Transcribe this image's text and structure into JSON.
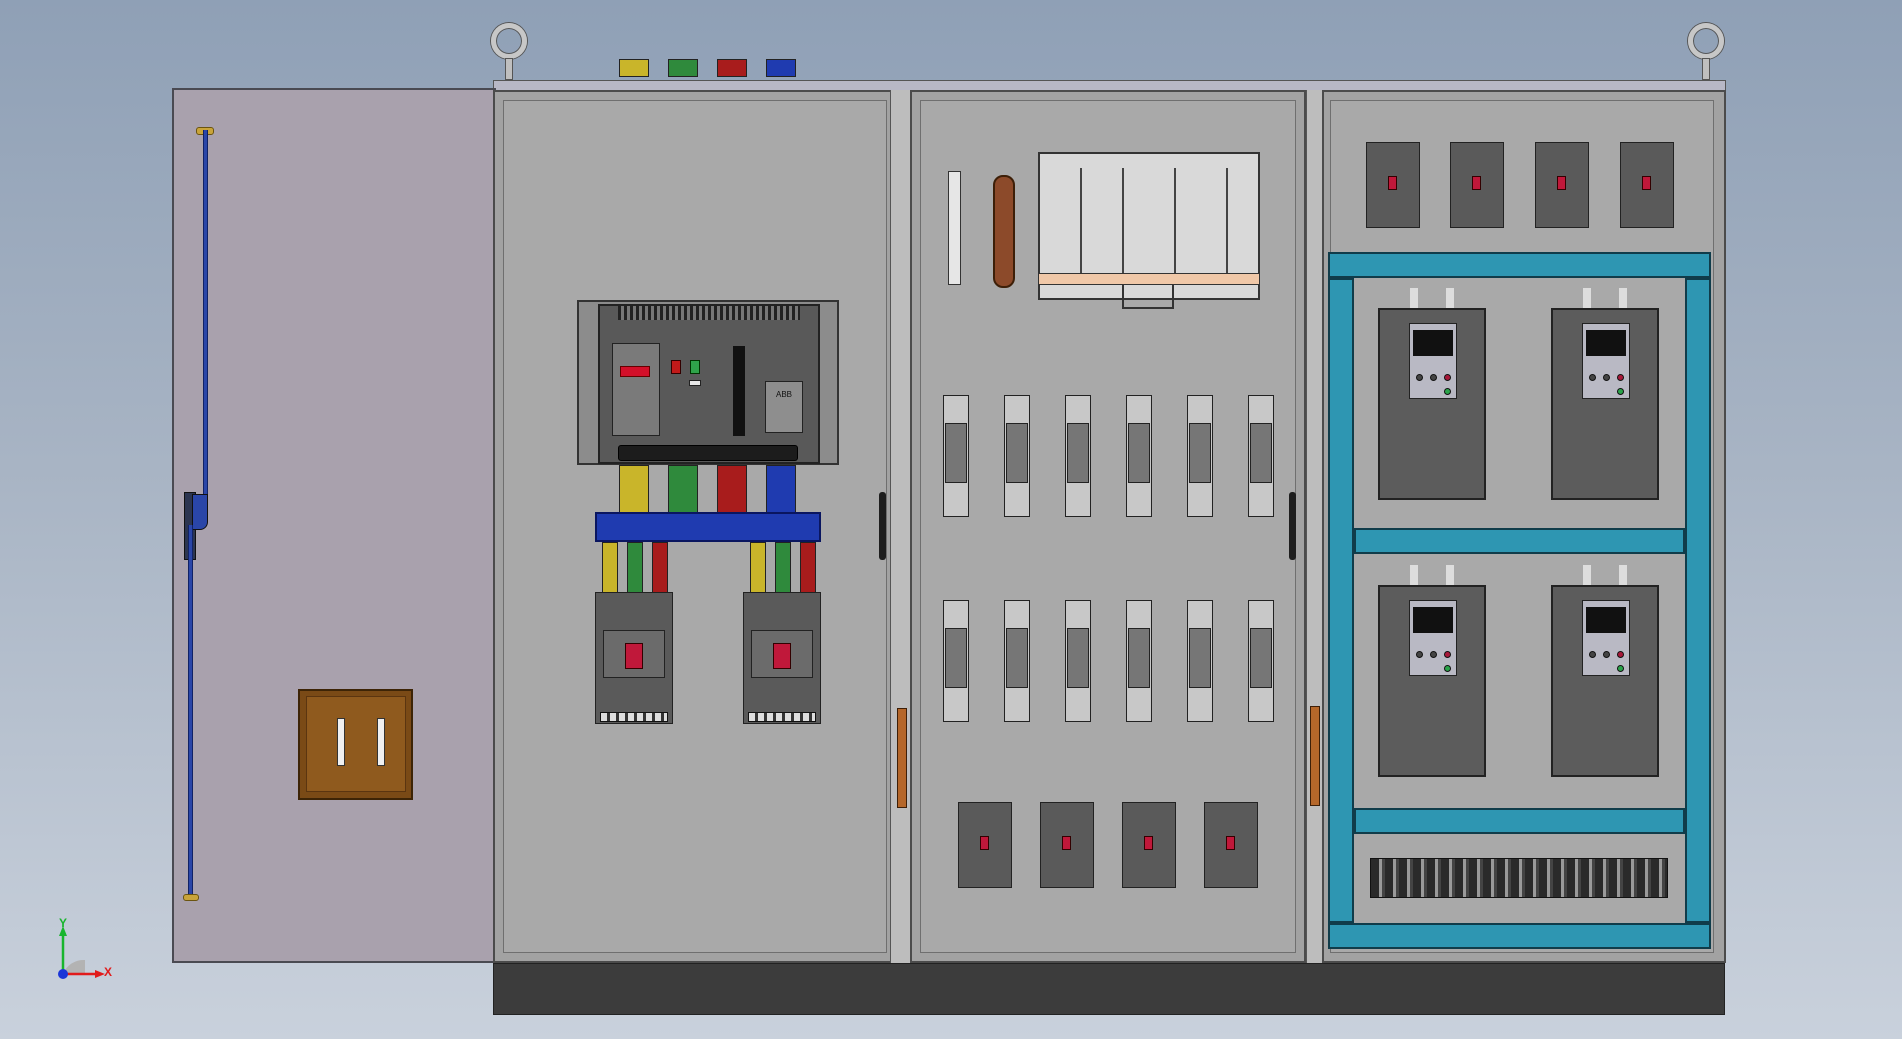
{
  "viewport": {
    "background_top": "#8fa0b6",
    "background_bottom": "#c9d1dc"
  },
  "scene": {
    "door_color": "#a9a1ad",
    "panel_gray": "#a9a9a9",
    "busbar_colors": [
      "#c9b52a",
      "#2f8a3c",
      "#a81c1c",
      "#1f3bb0"
    ],
    "duct_color": "#2e96b2",
    "copper_color": "#8c4a2a",
    "acb_label": "ABB",
    "fuse_count": 12,
    "mccb_small_count": 8,
    "mccb_large_count": 2,
    "vfd_count": 4
  },
  "axis_triad": {
    "x_label": "X",
    "y_label": "Y",
    "x_color": "#e11b1b",
    "y_color": "#18b52d",
    "z_color": "#1a36d8"
  }
}
